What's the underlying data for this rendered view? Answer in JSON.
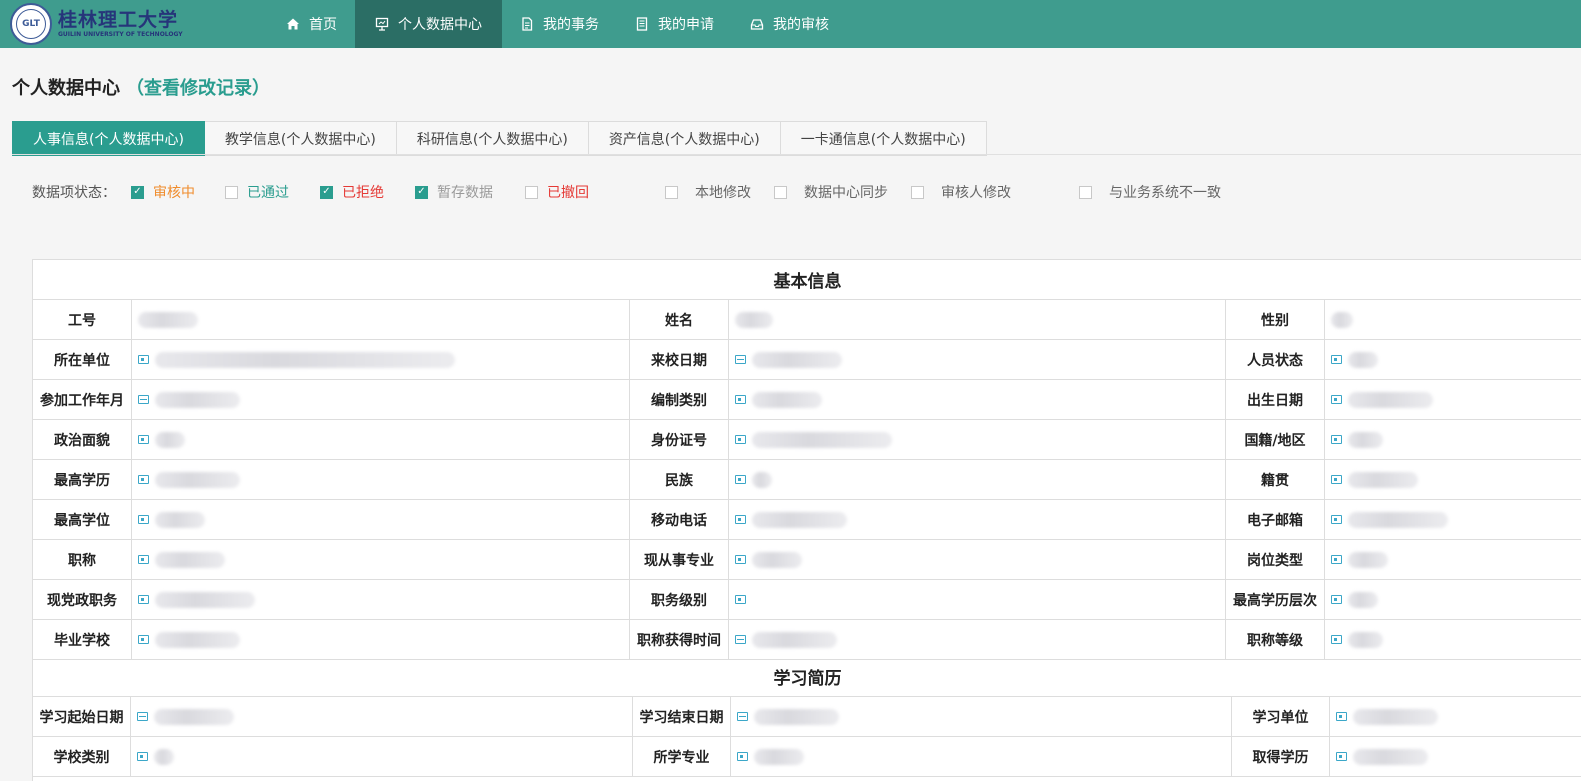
{
  "logo": {
    "cn": "桂林理工大学",
    "en": "GUILIN UNIVERSITY OF TECHNOLOGY"
  },
  "nav": [
    {
      "label": "首页",
      "icon": "home-icon",
      "active": false
    },
    {
      "label": "个人数据中心",
      "icon": "presentation-icon",
      "active": true
    },
    {
      "label": "我的事务",
      "icon": "document-icon",
      "active": false
    },
    {
      "label": "我的申请",
      "icon": "list-document-icon",
      "active": false
    },
    {
      "label": "我的审核",
      "icon": "inbox-icon",
      "active": false
    }
  ],
  "page": {
    "title": "个人数据中心",
    "link": "（查看修改记录）"
  },
  "tabs": [
    {
      "label": "人事信息(个人数据中心)",
      "active": true
    },
    {
      "label": "教学信息(个人数据中心)",
      "active": false
    },
    {
      "label": "科研信息(个人数据中心)",
      "active": false
    },
    {
      "label": "资产信息(个人数据中心)",
      "active": false
    },
    {
      "label": "一卡通信息(个人数据中心)",
      "active": false
    }
  ],
  "status": {
    "label": "数据项状态：",
    "items": [
      {
        "label": "审核中",
        "checked": true,
        "color": "#f08c2c"
      },
      {
        "label": "已通过",
        "checked": false,
        "color": "#2a9d8f"
      },
      {
        "label": "已拒绝",
        "checked": true,
        "color": "#e53935"
      },
      {
        "label": "暂存数据",
        "checked": true,
        "color": "#9a9a9a"
      },
      {
        "label": "已撤回",
        "checked": false,
        "color": "#e53935"
      },
      {
        "label": "本地修改",
        "checked": false,
        "color": "#666666"
      },
      {
        "label": "数据中心同步",
        "checked": false,
        "color": "#666666"
      },
      {
        "label": "审核人修改",
        "checked": false,
        "color": "#666666"
      },
      {
        "label": "与业务系统不一致",
        "checked": false,
        "color": "#666666"
      }
    ]
  },
  "sections": {
    "basic": "基本信息",
    "study": "学习简历"
  },
  "basic_rows": [
    [
      "工号",
      "姓名",
      "性别"
    ],
    [
      "所在单位",
      "来校日期",
      "人员状态"
    ],
    [
      "参加工作年月",
      "编制类别",
      "出生日期"
    ],
    [
      "政治面貌",
      "身份证号",
      "国籍/地区"
    ],
    [
      "最高学历",
      "民族",
      "籍贯"
    ],
    [
      "最高学位",
      "移动电话",
      "电子邮箱"
    ],
    [
      "职称",
      "现从事专业",
      "岗位类型"
    ],
    [
      "现党政职务",
      "职务级别",
      "最高学历层次"
    ],
    [
      "毕业学校",
      "职称获得时间",
      "职称等级"
    ]
  ],
  "study_rows": [
    [
      "学习起始日期",
      "学习结束日期",
      "学习单位"
    ],
    [
      "学校类别",
      "所学专业",
      "取得学历"
    ]
  ]
}
